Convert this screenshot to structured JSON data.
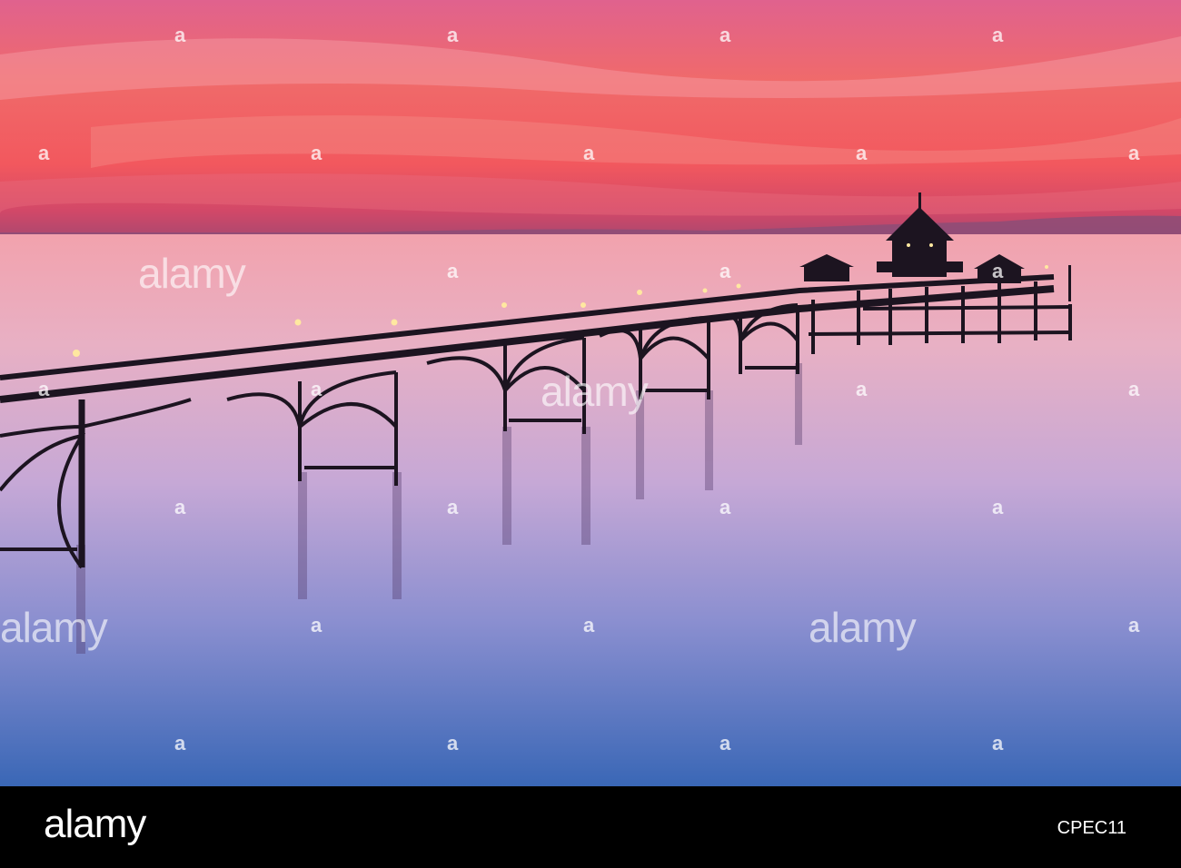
{
  "watermark": {
    "text": "alamy",
    "mark": "a"
  },
  "footer": {
    "brand": "alamy",
    "image_ref": "CPEC11"
  },
  "colors": {
    "sky_top": "#e4688a",
    "sky_mid": "#f0566a",
    "horizon": "#b44a6a",
    "sea_top": "#e9a6b6",
    "sea_mid": "#b79fd1",
    "sea_bottom": "#3f6ab4",
    "pier": "#1c1420",
    "lamp": "#ffe8a0"
  }
}
